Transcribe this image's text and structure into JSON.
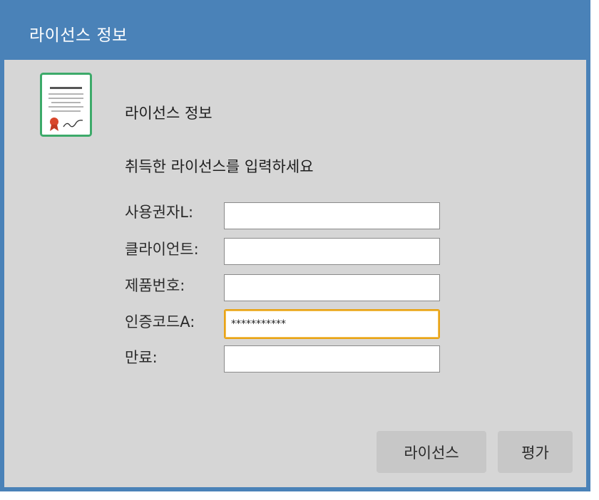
{
  "window": {
    "title": "라이선스 정보"
  },
  "header": {
    "icon": "certificate-icon",
    "heading": "라이선스 정보",
    "instruction": "취득한 라이선스를 입력하세요"
  },
  "form": {
    "fields": [
      {
        "label": "사용권자L:",
        "value": "",
        "placeholder": ""
      },
      {
        "label": "클라이언트:",
        "value": "",
        "placeholder": ""
      },
      {
        "label": "제품번호:",
        "value": "",
        "placeholder": ""
      },
      {
        "label": "인증코드A:",
        "value": "***********",
        "placeholder": "",
        "focused": true
      },
      {
        "label": "만료:",
        "value": "",
        "placeholder": ""
      }
    ]
  },
  "buttons": {
    "license_label": "라이선스",
    "trial_label": "평가"
  },
  "colors": {
    "titlebar": "#4a82b8",
    "content_bg": "#d6d6d6",
    "focus_border": "#e8a317",
    "button_bg": "#c7c7c7",
    "icon_border": "#3daa6a"
  }
}
